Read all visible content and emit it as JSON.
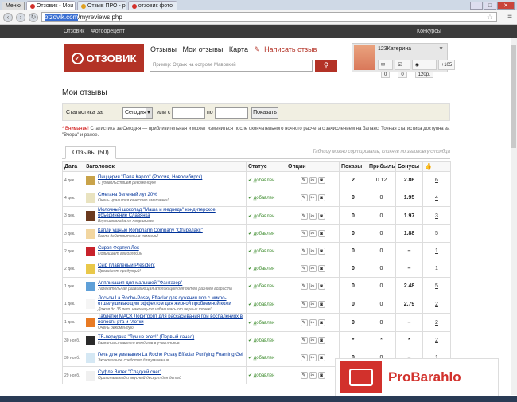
{
  "browser": {
    "menu_label": "Меню",
    "tabs": [
      {
        "label": "Отзовик - Мои отзывы",
        "active": true,
        "color": "#d2312c"
      },
      {
        "label": "Отзыв ПРО - реальные о...",
        "active": false,
        "color": "#e0a020"
      },
      {
        "label": "отзовик фото — Яндекс...",
        "active": false,
        "color": "#d2312c"
      }
    ],
    "url_host": "otzovik.com",
    "url_path": "/myreviews.php"
  },
  "topbar": {
    "links": [
      "Отзовик",
      "Фотоорецепт"
    ],
    "right": "Конкурсы"
  },
  "header": {
    "logo_text": "ОТЗОВИК",
    "nav": [
      "Отзывы",
      "Мои отзывы",
      "Карта"
    ],
    "write_review": "Написать отзыв",
    "search_placeholder": "Пример: Отдых на острове Маврикий",
    "profile": {
      "name": "123Катерина",
      "stats": [
        "0",
        "0",
        "120р.",
        "+105"
      ]
    }
  },
  "page": {
    "title": "Мои отзывы",
    "filter": {
      "stats_label": "Статистика за:",
      "period_selected": "Сегодня",
      "or_label": "или с",
      "to_label": "по",
      "show_button": "Показать"
    },
    "note_warning": "* Внимание!",
    "note_text": " Статистика за Сегодня — приблизительная и может измениться после окончательного ночного расчета с зачислением на баланс. Точная статистика доступна за \"Вчера\" и ранее.",
    "reviews_tab": "Отзывы (50)",
    "sort_hint": "Таблицу можно сортировать, кликнув по заголовку столбца"
  },
  "table": {
    "headers": [
      "Дата",
      "Заголовок",
      "Статус",
      "Опции",
      "Показы",
      "Прибыль",
      "Бонусы",
      ""
    ],
    "rows": [
      {
        "date": "4 дек.",
        "title": "Пиццерия \"Папа Карло\" (Россия, Новосибирск)",
        "subtitle": "С удовольствием рекомендую!",
        "status": "добавлен",
        "views": "2",
        "profit": "0.12",
        "bonus": "2.86",
        "likes": "6"
      },
      {
        "date": "4 дек.",
        "title": "Сметана Зеленый луг 20%",
        "subtitle": "Очень нравится качество сметанки!",
        "status": "добавлен",
        "views": "0",
        "profit": "0",
        "bonus": "1.95",
        "likes": "4"
      },
      {
        "date": "3 дек.",
        "title": "Молочный шоколад \"Маша и медведь\" кондитерское объединение Славянка",
        "subtitle": "Вкус шоколада не понравился",
        "status": "добавлен",
        "views": "0",
        "profit": "0",
        "bonus": "1.97",
        "likes": "3"
      },
      {
        "date": "3 дек.",
        "title": "Капли ушные Rompharm Company \"Отирелакс\"",
        "subtitle": "Капли действительно помогли!",
        "status": "добавлен",
        "views": "0",
        "profit": "0",
        "bonus": "1.88",
        "likes": "5"
      },
      {
        "date": "2 дек.",
        "title": "Сироп Ферпул Лек",
        "subtitle": "Повышает гемоглобин",
        "status": "добавлен",
        "views": "0",
        "profit": "0",
        "bonus": "–",
        "likes": "1"
      },
      {
        "date": "2 дек.",
        "title": "Сыр плавленый President",
        "subtitle": "Президент продукций!",
        "status": "добавлен",
        "views": "0",
        "profit": "0",
        "bonus": "–",
        "likes": "1"
      },
      {
        "date": "1 дек.",
        "title": "Аппликация для малышей \"Фантазер\"",
        "subtitle": "Увлекательная развивающая аппликация для детей разного возраста",
        "status": "добавлен",
        "views": "0",
        "profit": "0",
        "bonus": "2.48",
        "likes": "5"
      },
      {
        "date": "1 дек.",
        "title": "Лосьон La Roche-Posay Effaclar для сужения пор с микро-отшелушивающим эффектом для жирной проблемной кожи",
        "subtitle": "Дожив до 35 лет, наконец-то избавилась от черных точек!",
        "status": "добавлен",
        "views": "0",
        "profit": "0",
        "bonus": "2.79",
        "likes": "2"
      },
      {
        "date": "1 дек.",
        "title": "Таблетки МАСК Лоритропт для рассасывания при воспалениях в полости рта и глотки",
        "subtitle": "Очень рекомендую!",
        "status": "добавлен",
        "views": "0",
        "profit": "0",
        "bonus": "–",
        "likes": "2"
      },
      {
        "date": "30 нояб.",
        "title": "ТВ-передача \"Лучше всех!\" (Первый канал)",
        "subtitle": "Галкин заставляет влюдить в участников",
        "status": "добавлен",
        "views": "*",
        "profit": "*",
        "bonus": "*",
        "likes": "2"
      },
      {
        "date": "30 нояб.",
        "title": "Гель для умывания La Roche Posay Effaclar Purifying Foaming Gel",
        "subtitle": "Экономичное средство для умывания",
        "status": "добавлен",
        "views": "0",
        "profit": "0",
        "bonus": "–",
        "likes": "1"
      },
      {
        "date": "29 нояб.",
        "title": "Суфле Витек \"Сладкий снег\"",
        "subtitle": "Оригинальный и вкусный десерт для детей",
        "status": "добавлен",
        "views": "0",
        "profit": "0",
        "bonus": "–",
        "likes": "1"
      }
    ]
  },
  "watermark": "ProBarahlo"
}
